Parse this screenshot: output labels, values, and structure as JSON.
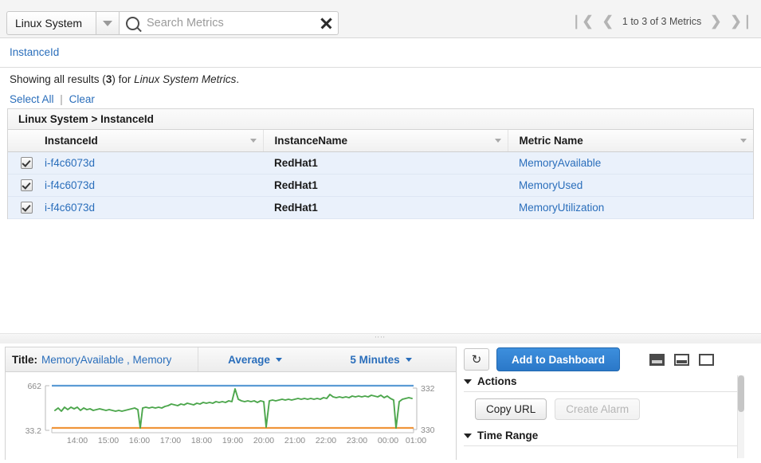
{
  "search": {
    "namespace": "Linux System",
    "namespace_caret_icon": "chevron-down-icon",
    "search_icon": "search-icon",
    "placeholder": "Search Metrics",
    "value": "",
    "clear_icon": "close-icon"
  },
  "pager": {
    "first_icon": "❘❮",
    "prev_icon": "❮",
    "label": "1 to 3 of 3 Metrics",
    "next_icon": "❯",
    "last_icon": "❯❘"
  },
  "breadcrumb": {
    "dimension": "InstanceId"
  },
  "results": {
    "showing_prefix": "Showing all results (",
    "showing_count": "3",
    "showing_mid": ") for ",
    "showing_scope": "Linux System Metrics",
    "showing_suffix": ".",
    "select_all": "Select All",
    "separator": "|",
    "clear": "Clear"
  },
  "table": {
    "caption": "Linux System > InstanceId",
    "columns": [
      "InstanceId",
      "InstanceName",
      "Metric Name"
    ],
    "sort_icon": "chevron-down-icon",
    "rows": [
      {
        "checked": true,
        "instance_id": "i-f4c6073d",
        "instance_name": "RedHat1",
        "metric_name": "MemoryAvailable"
      },
      {
        "checked": true,
        "instance_id": "i-f4c6073d",
        "instance_name": "RedHat1",
        "metric_name": "MemoryUsed"
      },
      {
        "checked": true,
        "instance_id": "i-f4c6073d",
        "instance_name": "RedHat1",
        "metric_name": "MemoryUtilization"
      }
    ]
  },
  "splitter": {
    "grip_icon": "resize-grip-icon"
  },
  "graph": {
    "title_label": "Title:",
    "title_value": "MemoryAvailable , Memory",
    "statistic": "Average",
    "statistic_caret_icon": "chevron-down-icon",
    "period": "5 Minutes",
    "period_caret_icon": "chevron-down-icon"
  },
  "options": {
    "refresh_icon": "refresh-icon",
    "add_to_dashboard": "Add to Dashboard",
    "layout_icons": [
      "layout-bottom-icon",
      "layout-split-icon",
      "layout-full-icon"
    ],
    "actions_section": "Actions",
    "actions_twisty_icon": "triangle-down-icon",
    "copy_url": "Copy URL",
    "create_alarm": "Create Alarm",
    "create_alarm_disabled": true,
    "time_range_section": "Time Range",
    "time_range_twisty_icon": "triangle-down-icon"
  },
  "colors": {
    "link": "#2a6ebb",
    "primary_button": "#2b78c8",
    "series_blue": "#5b9bd5",
    "series_green": "#4ca64c",
    "series_orange": "#f0953a",
    "row_highlight": "#eaf1fb"
  },
  "chart_data": {
    "type": "line",
    "title": "MemoryAvailable , Memory",
    "xlabel": "",
    "ylabel": "",
    "statistic": "Average",
    "period": "5 Minutes",
    "grid": false,
    "legend": "none",
    "left_axis": {
      "ticks": [
        "33.2",
        "662"
      ],
      "min": 33.2,
      "max": 662
    },
    "right_axis": {
      "ticks": [
        "330",
        "332"
      ],
      "min": 330,
      "max": 332
    },
    "x_ticks": [
      "14:00",
      "15:00",
      "16:00",
      "17:00",
      "18:00",
      "19:00",
      "20:00",
      "21:00",
      "22:00",
      "23:00",
      "00:00",
      "01:00"
    ],
    "series": [
      {
        "name": "MemoryUsed",
        "color": "#5b9bd5",
        "axis": "left",
        "values": [
          662,
          662,
          662,
          662,
          662,
          662,
          662,
          662,
          662,
          662,
          662,
          662,
          662,
          662,
          662,
          662,
          662,
          662,
          662,
          662,
          662,
          662,
          662,
          662,
          662,
          662,
          662,
          662,
          662,
          662,
          662,
          662,
          662,
          662,
          662,
          662,
          662,
          662,
          662,
          662,
          662,
          662,
          662,
          662,
          662,
          662,
          662,
          662,
          662,
          662,
          662,
          662,
          662,
          662,
          662,
          662,
          662,
          662,
          662,
          662
        ]
      },
      {
        "name": "MemoryUtilization",
        "color": "#4ca64c",
        "axis": "right",
        "values": [
          330.95,
          330.85,
          330.95,
          331.1,
          330.95,
          331.05,
          331.0,
          331.15,
          331.05,
          330.95,
          331.0,
          330.95,
          330.9,
          330.95,
          330.95,
          331.0,
          331.1,
          331.15,
          331.05,
          331.1,
          330.1,
          331.05,
          331.0,
          331.05,
          331.1,
          331.05,
          331.2,
          331.35,
          331.25,
          331.2,
          331.3,
          331.25,
          331.35,
          331.3,
          331.35,
          331.4,
          331.35,
          332.0,
          331.4,
          331.35,
          331.3,
          331.25,
          331.3,
          331.4,
          331.35,
          330.2,
          331.3,
          331.35,
          331.4,
          331.35,
          331.4,
          331.45,
          331.4,
          331.7,
          331.5,
          331.55,
          331.6,
          331.55,
          331.65,
          331.6,
          331.65,
          331.6,
          331.7,
          331.65,
          331.5,
          331.6,
          331.55,
          330.25,
          331.45,
          331.55,
          331.65,
          331.6
        ]
      },
      {
        "name": "MemoryAvailable",
        "color": "#f0953a",
        "axis": "left",
        "values": [
          33.2,
          33.2,
          33.2,
          33.2,
          33.2,
          33.2,
          33.2,
          33.2,
          33.2,
          33.2,
          33.2,
          33.2,
          33.2,
          33.2,
          33.2,
          33.2,
          33.2,
          33.2,
          33.2,
          33.2,
          33.2,
          33.2,
          33.2,
          33.2,
          33.2,
          33.2,
          33.2,
          33.2,
          33.2,
          33.2,
          33.2,
          33.2,
          33.2,
          33.2,
          33.2,
          33.2,
          33.2,
          33.2,
          33.2,
          33.2,
          33.2,
          33.2,
          33.2,
          33.2,
          33.2,
          33.2,
          33.2,
          33.2,
          33.2,
          33.2,
          33.2,
          33.2,
          33.2,
          33.2,
          33.2,
          33.2,
          33.2,
          33.2,
          33.2,
          33.2
        ]
      }
    ]
  }
}
